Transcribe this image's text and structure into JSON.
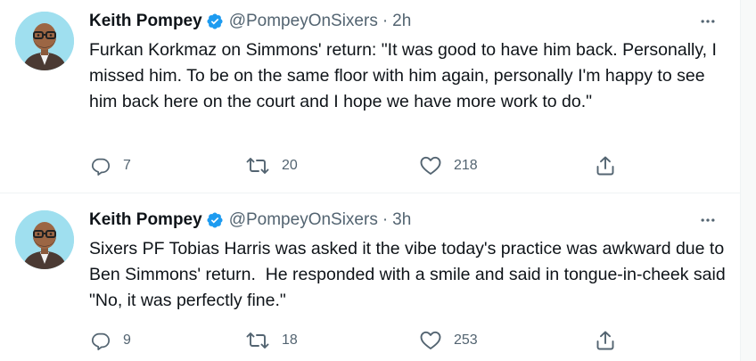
{
  "tweets": [
    {
      "name": "Keith Pompey",
      "handle": "@PompeyOnSixers",
      "separator": "·",
      "time": "2h",
      "text": "Furkan Korkmaz on Simmons' return: \"It was good to have him back. Personally, I missed him. To be on the same floor with him again, personally I'm happy to see him back here on the court and I hope we have more work to do.\"",
      "replies": "7",
      "retweets": "20",
      "likes": "218",
      "avatar_icon": "bitmoji-avatar",
      "verified_icon": "verified-badge-icon"
    },
    {
      "name": "Keith Pompey",
      "handle": "@PompeyOnSixers",
      "separator": "·",
      "time": "3h",
      "text": "Sixers PF Tobias Harris was asked it the vibe today's practice was awkward due to Ben Simmons' return.  He responded with a smile and said in tongue-in-cheek said \"No, it was perfectly fine.\"",
      "replies": "9",
      "retweets": "18",
      "likes": "253",
      "avatar_icon": "bitmoji-avatar",
      "verified_icon": "verified-badge-icon"
    }
  ],
  "colors": {
    "text_primary": "#0f1419",
    "text_secondary": "#536471",
    "verified_blue": "#1d9bf0",
    "avatar_bg": "#9fdfef",
    "divider": "#eff3f4"
  }
}
